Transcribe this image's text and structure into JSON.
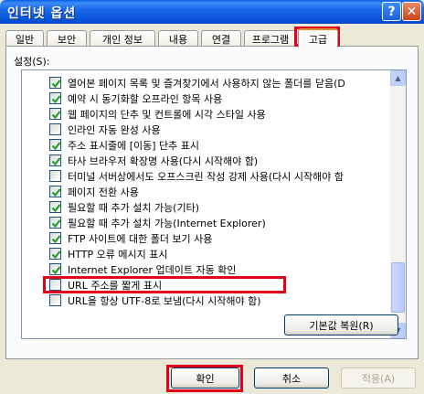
{
  "window": {
    "title": "인터넷 옵션",
    "help_glyph": "?",
    "close_glyph": "✕"
  },
  "tabs": [
    {
      "label": "일반"
    },
    {
      "label": "보안"
    },
    {
      "label": "개인 정보"
    },
    {
      "label": "내용"
    },
    {
      "label": "연결"
    },
    {
      "label": "프로그램"
    },
    {
      "label": "고급",
      "active": true
    }
  ],
  "settings": {
    "label": "설정(S):",
    "items": [
      {
        "label": "열어본 페이지 목록 및 즐겨찾기에서 사용하지 않는 폴더를 닫음(D",
        "checked": true
      },
      {
        "label": "예약 시 동기화할 오프라인 항목 사용",
        "checked": true
      },
      {
        "label": "웹 페이지의 단추 및 컨트롤에 시각 스타일 사용",
        "checked": true
      },
      {
        "label": "인라인 자동 완성 사용",
        "checked": false
      },
      {
        "label": "주소 표시줄에 [이동] 단추 표시",
        "checked": true
      },
      {
        "label": "타사 브라우저 확장명 사용(다시 시작해야 함)",
        "checked": true
      },
      {
        "label": "터미널 서버상에서도 오프스크린 작성 강제 사용(다시 시작해야 함",
        "checked": false
      },
      {
        "label": "페이지 전환 사용",
        "checked": true
      },
      {
        "label": "필요할 때 추가 설치 가능(기타)",
        "checked": true
      },
      {
        "label": "필요할 때 추가 설치 가능(Internet Explorer)",
        "checked": true
      },
      {
        "label": "FTP 사이트에 대한 폴더 보기 사용",
        "checked": true
      },
      {
        "label": "HTTP 오류 메시지 표시",
        "checked": true
      },
      {
        "label": "Internet Explorer 업데이트 자동 확인",
        "checked": true
      },
      {
        "label": "URL 주소를 짧게 표시",
        "checked": false
      },
      {
        "label": "URL을 항상 UTF-8로 보냄(다시 시작해야 함)",
        "checked": false
      }
    ]
  },
  "buttons": {
    "restore_defaults": "기본값 복원(R)",
    "ok": "확인",
    "cancel": "취소",
    "apply": "적용(A)"
  }
}
